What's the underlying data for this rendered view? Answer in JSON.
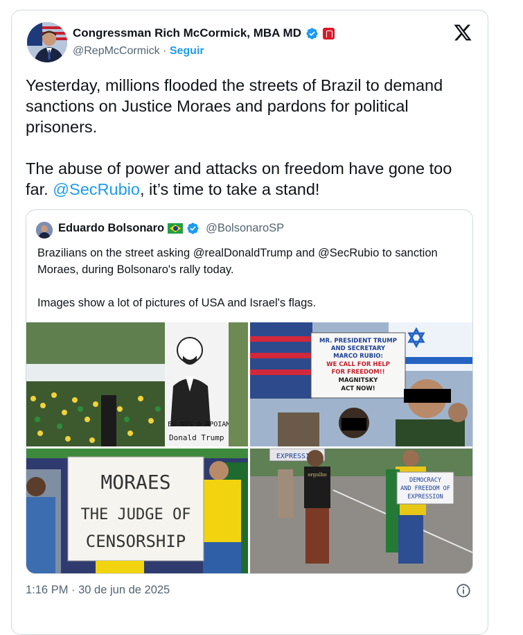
{
  "author": {
    "name": "Congressman Rich McCormick, MBA MD",
    "handle": "@RepMcCormick",
    "separator": "·",
    "follow_label": "Seguir"
  },
  "tweet": {
    "text_part1": "Yesterday, millions flooded the streets of Brazil to demand sanctions on Justice Moraes and pardons for political prisoners.\n\nThe abuse of power and attacks on freedom have gone too far. ",
    "mention": "@SecRubio",
    "text_part2": ", it’s time to take a stand!"
  },
  "quote": {
    "name": "Eduardo Bolsonaro",
    "handle": "@BolsonaroSP",
    "text": "Brazilians on the street asking @realDonaldTrump and @SecRubio to sanction Moraes, during Bolsonaro's rally today.\n\nImages show a lot of pictures of USA and Israel's flags."
  },
  "images": {
    "img1": {
      "sign_line1": "EU NÓS O APOIAMOS",
      "sign_line2": "Donald Trump"
    },
    "img2": {
      "sign_lines": [
        "MR. PRESIDENT TRUMP",
        "AND SECRETARY",
        "MARCO RUBIO:",
        "WE CALL FOR HELP",
        "FOR FREEDOM!!",
        "MAGNITSKY",
        "ACT NOW!"
      ]
    },
    "img3": {
      "sign_lines": [
        "MORAES",
        "THE JUDGE OF",
        "CENSORSHIP"
      ]
    },
    "img4": {
      "sign_top": "EXPRESSION",
      "sign_lines": [
        "DEMOCRACY",
        "AND FREEDOM OF",
        "EXPRESSION"
      ],
      "shirt_text": "orgulho"
    }
  },
  "footer": {
    "timestamp": "1:16 PM · 30 de jun de 2025"
  },
  "colors": {
    "accent": "#1d9bf0",
    "verified": "#1d9bf0",
    "border": "#cfd9de",
    "muted": "#536471"
  },
  "icons": [
    "verified-icon",
    "congress-badge-icon",
    "x-logo-icon",
    "brazil-flag-icon",
    "info-icon"
  ]
}
